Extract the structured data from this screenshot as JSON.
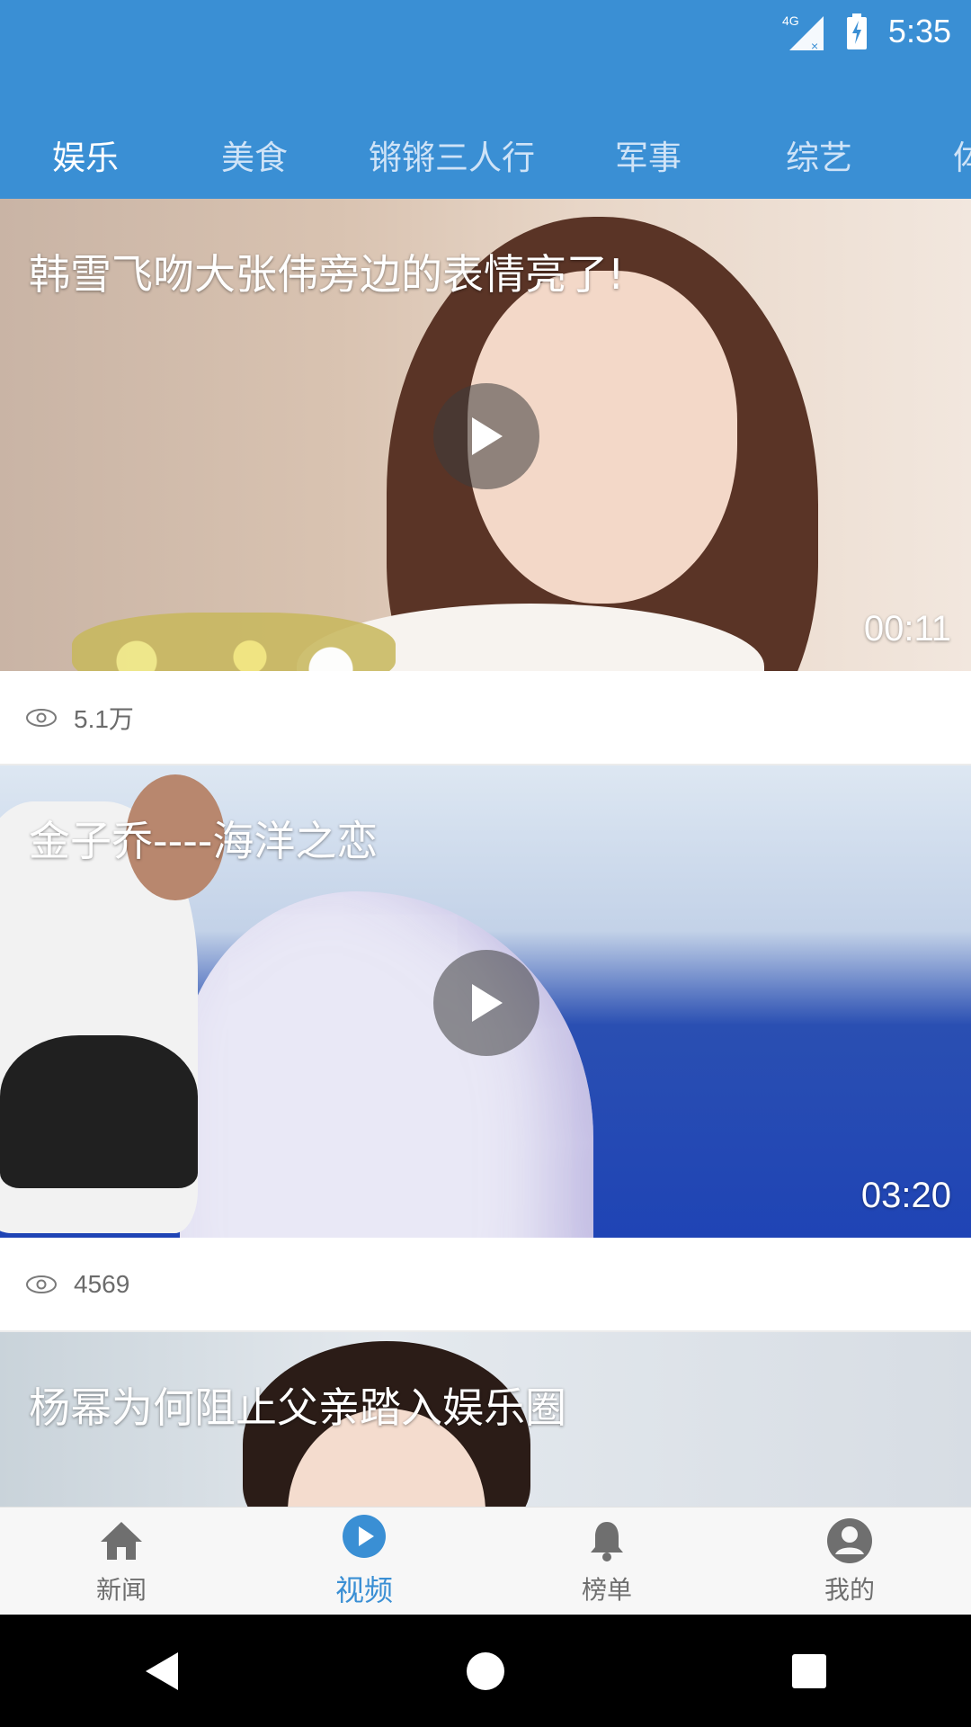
{
  "status_bar": {
    "network": "4G",
    "time": "5:35"
  },
  "tabs": [
    {
      "label": "娱乐",
      "active": true
    },
    {
      "label": "美食",
      "active": false
    },
    {
      "label": "锵锵三人行",
      "active": false
    },
    {
      "label": "军事",
      "active": false
    },
    {
      "label": "综艺",
      "active": false
    },
    {
      "label": "体",
      "active": false
    }
  ],
  "videos": [
    {
      "title": "韩雪飞吻大张伟旁边的表情亮了!",
      "duration": "00:11",
      "views": "5.1万"
    },
    {
      "title": "金子乔----海洋之恋",
      "duration": "03:20",
      "views": "4569"
    },
    {
      "title": "杨幂为何阻止父亲踏入娱乐圈",
      "duration": "",
      "views": ""
    }
  ],
  "bottom_nav": [
    {
      "label": "新闻",
      "icon": "home-icon",
      "active": false
    },
    {
      "label": "视频",
      "icon": "play-circle-icon",
      "active": true
    },
    {
      "label": "榜单",
      "icon": "bell-icon",
      "active": false
    },
    {
      "label": "我的",
      "icon": "account-icon",
      "active": false
    }
  ],
  "colors": {
    "primary": "#3a8fd4",
    "tab_inactive": "#cfe3f7",
    "nav_inactive": "#6f6f6f"
  }
}
